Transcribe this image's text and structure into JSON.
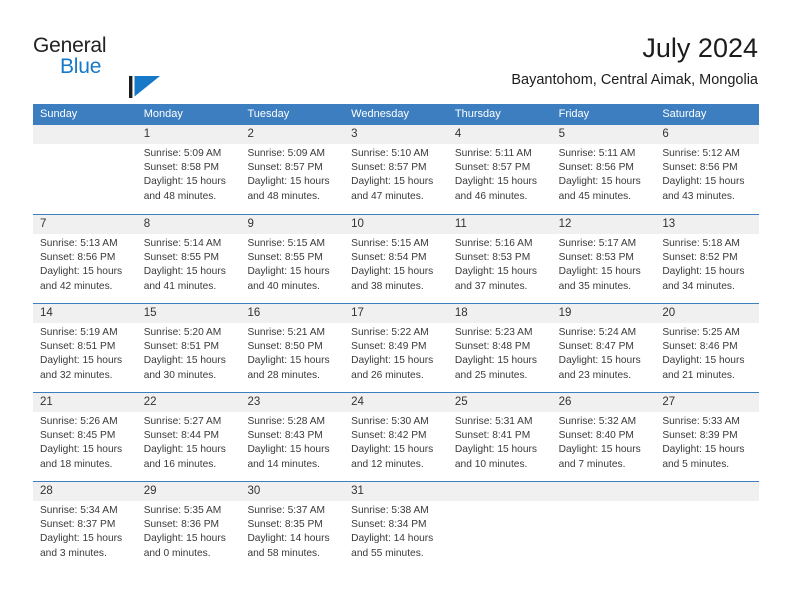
{
  "brand": {
    "name_part1": "General",
    "name_part2": "Blue",
    "mark": "triangle-flag-mark",
    "accent_color": "#1878c8"
  },
  "header": {
    "title": "July 2024",
    "subtitle": "Bayantohom, Central Aimak, Mongolia"
  },
  "colors": {
    "header_row_bg": "#3c7ebf",
    "day_number_bg": "#f0f0f0",
    "separator": "#3c7ebf",
    "text": "#3a3a3a"
  },
  "weekdays": [
    "Sunday",
    "Monday",
    "Tuesday",
    "Wednesday",
    "Thursday",
    "Friday",
    "Saturday"
  ],
  "weeks": [
    [
      {
        "day": "",
        "empty": true,
        "sunrise": "",
        "sunset": "",
        "daylight1": "",
        "daylight2": ""
      },
      {
        "day": "1",
        "sunrise": "Sunrise: 5:09 AM",
        "sunset": "Sunset: 8:58 PM",
        "daylight1": "Daylight: 15 hours",
        "daylight2": "and 48 minutes."
      },
      {
        "day": "2",
        "sunrise": "Sunrise: 5:09 AM",
        "sunset": "Sunset: 8:57 PM",
        "daylight1": "Daylight: 15 hours",
        "daylight2": "and 48 minutes."
      },
      {
        "day": "3",
        "sunrise": "Sunrise: 5:10 AM",
        "sunset": "Sunset: 8:57 PM",
        "daylight1": "Daylight: 15 hours",
        "daylight2": "and 47 minutes."
      },
      {
        "day": "4",
        "sunrise": "Sunrise: 5:11 AM",
        "sunset": "Sunset: 8:57 PM",
        "daylight1": "Daylight: 15 hours",
        "daylight2": "and 46 minutes."
      },
      {
        "day": "5",
        "sunrise": "Sunrise: 5:11 AM",
        "sunset": "Sunset: 8:56 PM",
        "daylight1": "Daylight: 15 hours",
        "daylight2": "and 45 minutes."
      },
      {
        "day": "6",
        "sunrise": "Sunrise: 5:12 AM",
        "sunset": "Sunset: 8:56 PM",
        "daylight1": "Daylight: 15 hours",
        "daylight2": "and 43 minutes."
      }
    ],
    [
      {
        "day": "7",
        "sunrise": "Sunrise: 5:13 AM",
        "sunset": "Sunset: 8:56 PM",
        "daylight1": "Daylight: 15 hours",
        "daylight2": "and 42 minutes."
      },
      {
        "day": "8",
        "sunrise": "Sunrise: 5:14 AM",
        "sunset": "Sunset: 8:55 PM",
        "daylight1": "Daylight: 15 hours",
        "daylight2": "and 41 minutes."
      },
      {
        "day": "9",
        "sunrise": "Sunrise: 5:15 AM",
        "sunset": "Sunset: 8:55 PM",
        "daylight1": "Daylight: 15 hours",
        "daylight2": "and 40 minutes."
      },
      {
        "day": "10",
        "sunrise": "Sunrise: 5:15 AM",
        "sunset": "Sunset: 8:54 PM",
        "daylight1": "Daylight: 15 hours",
        "daylight2": "and 38 minutes."
      },
      {
        "day": "11",
        "sunrise": "Sunrise: 5:16 AM",
        "sunset": "Sunset: 8:53 PM",
        "daylight1": "Daylight: 15 hours",
        "daylight2": "and 37 minutes."
      },
      {
        "day": "12",
        "sunrise": "Sunrise: 5:17 AM",
        "sunset": "Sunset: 8:53 PM",
        "daylight1": "Daylight: 15 hours",
        "daylight2": "and 35 minutes."
      },
      {
        "day": "13",
        "sunrise": "Sunrise: 5:18 AM",
        "sunset": "Sunset: 8:52 PM",
        "daylight1": "Daylight: 15 hours",
        "daylight2": "and 34 minutes."
      }
    ],
    [
      {
        "day": "14",
        "sunrise": "Sunrise: 5:19 AM",
        "sunset": "Sunset: 8:51 PM",
        "daylight1": "Daylight: 15 hours",
        "daylight2": "and 32 minutes."
      },
      {
        "day": "15",
        "sunrise": "Sunrise: 5:20 AM",
        "sunset": "Sunset: 8:51 PM",
        "daylight1": "Daylight: 15 hours",
        "daylight2": "and 30 minutes."
      },
      {
        "day": "16",
        "sunrise": "Sunrise: 5:21 AM",
        "sunset": "Sunset: 8:50 PM",
        "daylight1": "Daylight: 15 hours",
        "daylight2": "and 28 minutes."
      },
      {
        "day": "17",
        "sunrise": "Sunrise: 5:22 AM",
        "sunset": "Sunset: 8:49 PM",
        "daylight1": "Daylight: 15 hours",
        "daylight2": "and 26 minutes."
      },
      {
        "day": "18",
        "sunrise": "Sunrise: 5:23 AM",
        "sunset": "Sunset: 8:48 PM",
        "daylight1": "Daylight: 15 hours",
        "daylight2": "and 25 minutes."
      },
      {
        "day": "19",
        "sunrise": "Sunrise: 5:24 AM",
        "sunset": "Sunset: 8:47 PM",
        "daylight1": "Daylight: 15 hours",
        "daylight2": "and 23 minutes."
      },
      {
        "day": "20",
        "sunrise": "Sunrise: 5:25 AM",
        "sunset": "Sunset: 8:46 PM",
        "daylight1": "Daylight: 15 hours",
        "daylight2": "and 21 minutes."
      }
    ],
    [
      {
        "day": "21",
        "sunrise": "Sunrise: 5:26 AM",
        "sunset": "Sunset: 8:45 PM",
        "daylight1": "Daylight: 15 hours",
        "daylight2": "and 18 minutes."
      },
      {
        "day": "22",
        "sunrise": "Sunrise: 5:27 AM",
        "sunset": "Sunset: 8:44 PM",
        "daylight1": "Daylight: 15 hours",
        "daylight2": "and 16 minutes."
      },
      {
        "day": "23",
        "sunrise": "Sunrise: 5:28 AM",
        "sunset": "Sunset: 8:43 PM",
        "daylight1": "Daylight: 15 hours",
        "daylight2": "and 14 minutes."
      },
      {
        "day": "24",
        "sunrise": "Sunrise: 5:30 AM",
        "sunset": "Sunset: 8:42 PM",
        "daylight1": "Daylight: 15 hours",
        "daylight2": "and 12 minutes."
      },
      {
        "day": "25",
        "sunrise": "Sunrise: 5:31 AM",
        "sunset": "Sunset: 8:41 PM",
        "daylight1": "Daylight: 15 hours",
        "daylight2": "and 10 minutes."
      },
      {
        "day": "26",
        "sunrise": "Sunrise: 5:32 AM",
        "sunset": "Sunset: 8:40 PM",
        "daylight1": "Daylight: 15 hours",
        "daylight2": "and 7 minutes."
      },
      {
        "day": "27",
        "sunrise": "Sunrise: 5:33 AM",
        "sunset": "Sunset: 8:39 PM",
        "daylight1": "Daylight: 15 hours",
        "daylight2": "and 5 minutes."
      }
    ],
    [
      {
        "day": "28",
        "sunrise": "Sunrise: 5:34 AM",
        "sunset": "Sunset: 8:37 PM",
        "daylight1": "Daylight: 15 hours",
        "daylight2": "and 3 minutes."
      },
      {
        "day": "29",
        "sunrise": "Sunrise: 5:35 AM",
        "sunset": "Sunset: 8:36 PM",
        "daylight1": "Daylight: 15 hours",
        "daylight2": "and 0 minutes."
      },
      {
        "day": "30",
        "sunrise": "Sunrise: 5:37 AM",
        "sunset": "Sunset: 8:35 PM",
        "daylight1": "Daylight: 14 hours",
        "daylight2": "and 58 minutes."
      },
      {
        "day": "31",
        "sunrise": "Sunrise: 5:38 AM",
        "sunset": "Sunset: 8:34 PM",
        "daylight1": "Daylight: 14 hours",
        "daylight2": "and 55 minutes."
      },
      {
        "day": "",
        "empty": true,
        "sunrise": "",
        "sunset": "",
        "daylight1": "",
        "daylight2": ""
      },
      {
        "day": "",
        "empty": true,
        "sunrise": "",
        "sunset": "",
        "daylight1": "",
        "daylight2": ""
      },
      {
        "day": "",
        "empty": true,
        "sunrise": "",
        "sunset": "",
        "daylight1": "",
        "daylight2": ""
      }
    ]
  ]
}
